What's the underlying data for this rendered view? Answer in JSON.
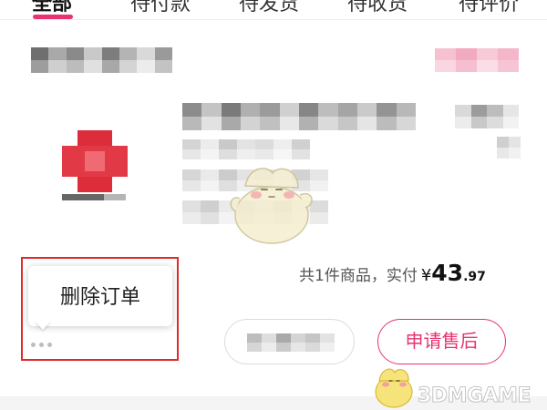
{
  "tabs": [
    {
      "label": "全部",
      "active": true
    },
    {
      "label": "待付款",
      "active": false
    },
    {
      "label": "待发货",
      "active": false
    },
    {
      "label": "待收货",
      "active": false
    },
    {
      "label": "待评价",
      "active": false
    }
  ],
  "order": {
    "summary_prefix": "共1件商品，实付",
    "currency": "¥",
    "amount_int": "43",
    "amount_dec": ".97"
  },
  "popup": {
    "label": "删除订单"
  },
  "buttons": {
    "after_sale": "申请售后"
  },
  "watermark": {
    "text": "3DMGAME"
  },
  "colors": {
    "accent": "#e8336e",
    "highlight": "#e02a2a"
  }
}
